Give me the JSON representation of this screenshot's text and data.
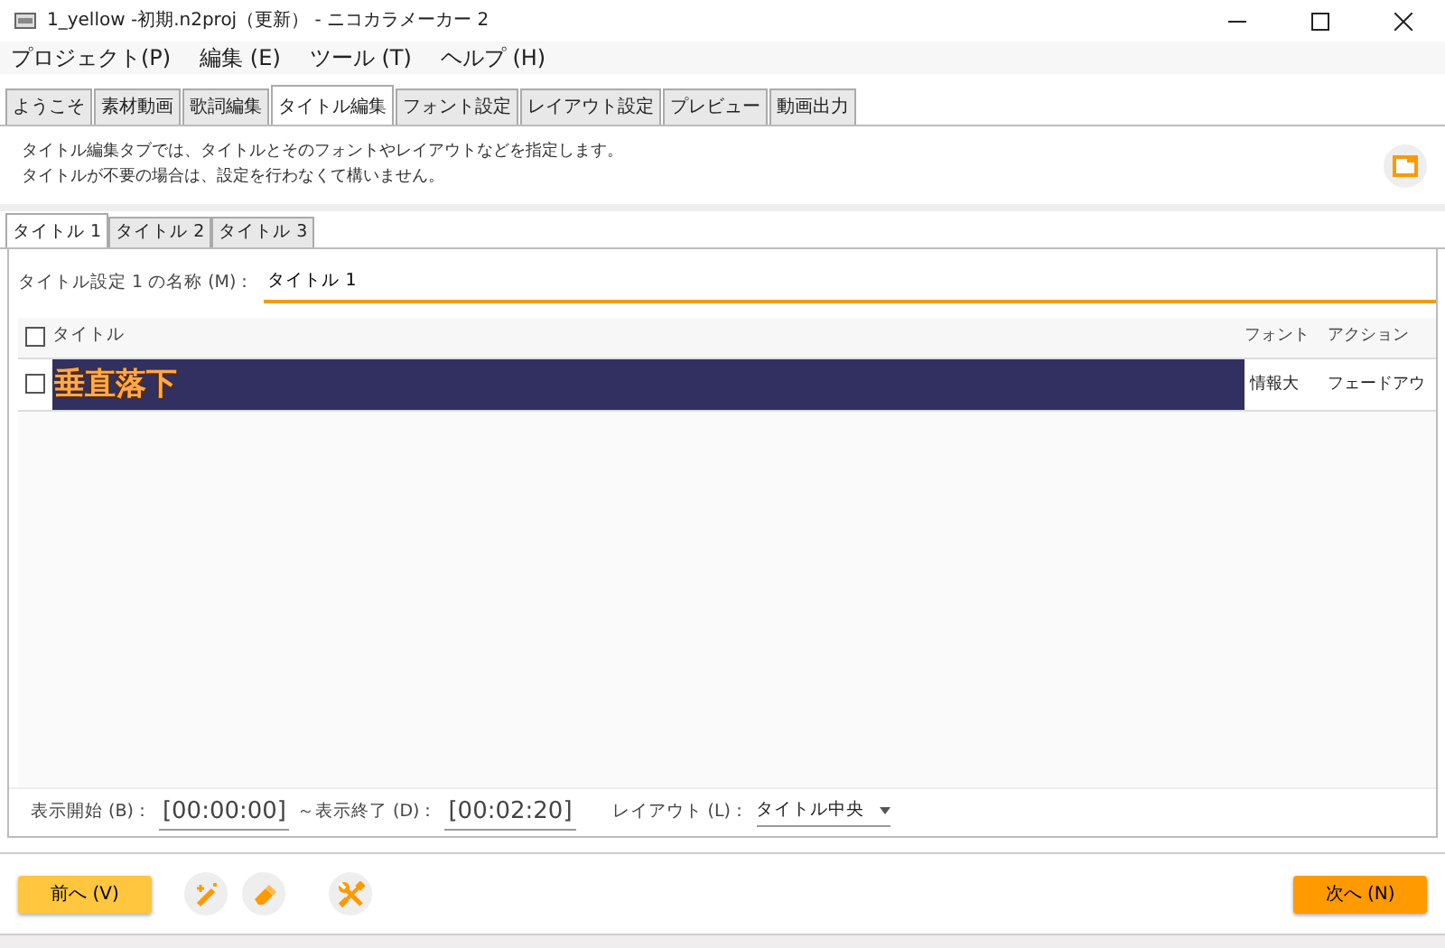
{
  "window": {
    "title": "1_yellow -初期.n2proj（更新） - ニコカラメーカー 2"
  },
  "menu": [
    "プロジェクト(P)",
    "編集 (E)",
    "ツール (T)",
    "ヘルプ (H)"
  ],
  "tabs": [
    {
      "label": "ようこそ",
      "selected": false
    },
    {
      "label": "素材動画",
      "selected": false
    },
    {
      "label": "歌詞編集",
      "selected": false
    },
    {
      "label": "タイトル編集",
      "selected": true
    },
    {
      "label": "フォント設定",
      "selected": false
    },
    {
      "label": "レイアウト設定",
      "selected": false
    },
    {
      "label": "プレビュー",
      "selected": false
    },
    {
      "label": "動画出力",
      "selected": false
    }
  ],
  "description": [
    "タイトル編集タブでは、タイトルとそのフォントやレイアウトなどを指定します。",
    "タイトルが不要の場合は、設定を行わなくて構いません。"
  ],
  "subtabs": [
    {
      "label": "タイトル 1",
      "selected": true
    },
    {
      "label": "タイトル 2",
      "selected": false
    },
    {
      "label": "タイトル 3",
      "selected": false
    }
  ],
  "name_field": {
    "label": "タイトル設定 1 の名称 (M)：",
    "value": "タイトル 1"
  },
  "table": {
    "header_checked": false,
    "columns": [
      "タイトル",
      "フォント",
      "アクション"
    ],
    "rows": [
      {
        "checked": false,
        "title": "垂直落下",
        "font": "情報大",
        "action": "フェードアウ"
      }
    ]
  },
  "timing": {
    "start_label": "表示開始 (B)：",
    "start": "[00:00:00]",
    "end_label": "～表示終了 (D)：",
    "end": "[00:02:20]",
    "layout_label": "レイアウト (L)：",
    "layout": "タイトル中央"
  },
  "buttons": {
    "prev": "前へ (V)",
    "next": "次へ (N)"
  }
}
